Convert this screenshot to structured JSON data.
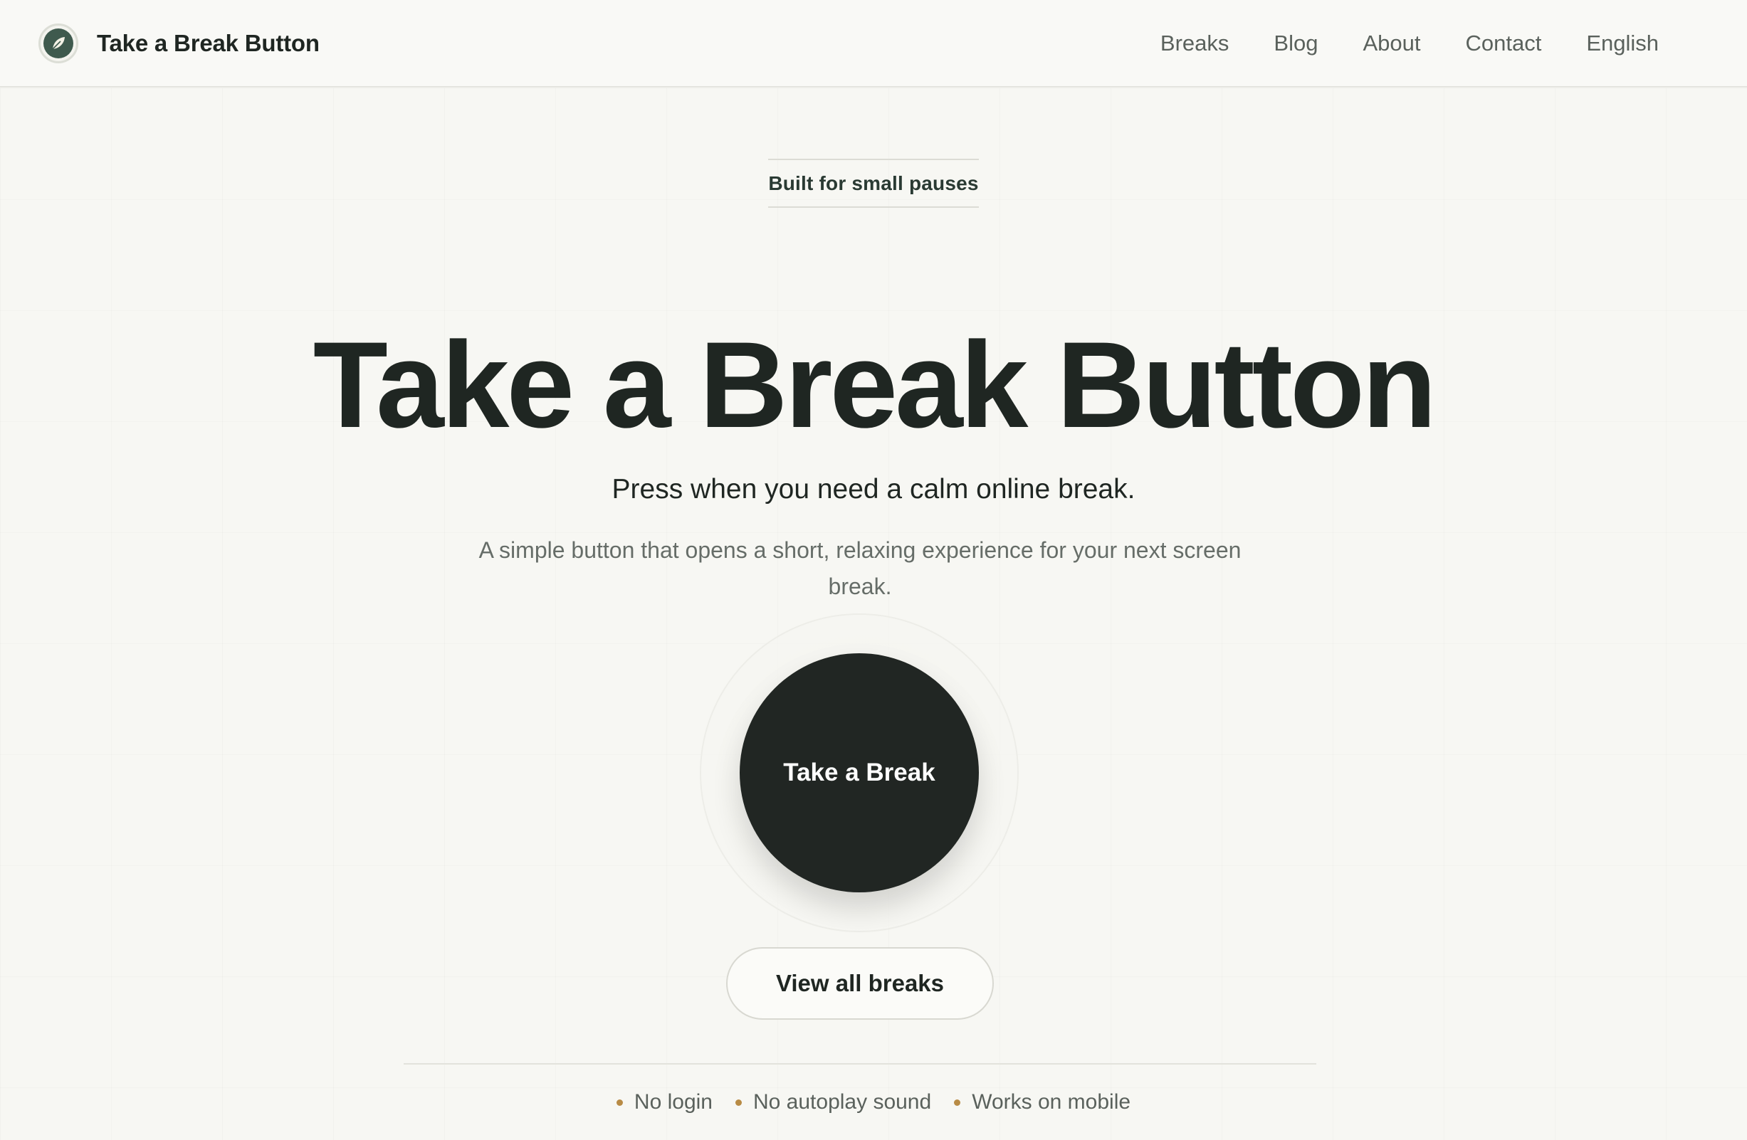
{
  "header": {
    "brand": "Take a Break Button",
    "logo_icon": "leaf-icon",
    "nav": [
      {
        "label": "Breaks"
      },
      {
        "label": "Blog"
      },
      {
        "label": "About"
      },
      {
        "label": "Contact"
      },
      {
        "label": "English"
      }
    ]
  },
  "hero": {
    "eyebrow": "Built for small pauses",
    "title": "Take a Break Button",
    "subtitle": "Press when you need a calm online break.",
    "description": "A simple button that opens a short, relaxing experience for your next screen break.",
    "primary_button": "Take a Break",
    "secondary_button": "View all breaks"
  },
  "features": [
    {
      "label": "No login"
    },
    {
      "label": "No autoplay sound"
    },
    {
      "label": "Works on mobile"
    }
  ],
  "colors": {
    "background": "#f7f7f3",
    "text": "#1f2622",
    "button_dark": "#212623",
    "accent_dot": "#b88b45",
    "logo_green": "#3f5a4e"
  }
}
